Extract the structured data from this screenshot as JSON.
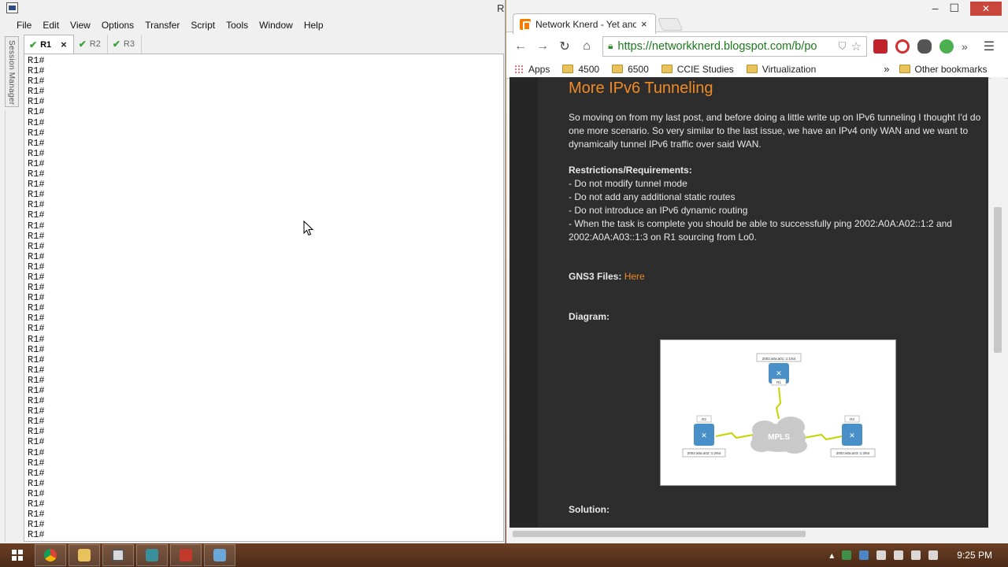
{
  "crt": {
    "title_fragment": "R",
    "menu": [
      "File",
      "Edit",
      "View",
      "Options",
      "Transfer",
      "Script",
      "Tools",
      "Window",
      "Help"
    ],
    "session_manager_label": "Session Manager",
    "tabs": [
      {
        "label": "R1",
        "active": true
      },
      {
        "label": "R2",
        "active": false
      },
      {
        "label": "R3",
        "active": false
      }
    ],
    "tab_close_glyph": "×",
    "terminal_prompt": "R1#",
    "terminal_line_count": 47
  },
  "chrome": {
    "tab_title": "Network Knerd - Yet anoth",
    "tab_close_glyph": "×",
    "url": "https://networkknerd.blogspot.com/b/po",
    "bookmarks": [
      {
        "label": "Apps",
        "icon": "apps-icon"
      },
      {
        "label": "4500",
        "icon": "folder-icon"
      },
      {
        "label": "6500",
        "icon": "folder-icon"
      },
      {
        "label": "CCIE Studies",
        "icon": "folder-icon"
      },
      {
        "label": "Virtualization",
        "icon": "folder-icon"
      }
    ],
    "bookmarks_overflow": "»",
    "other_bookmarks": "Other bookmarks"
  },
  "post": {
    "title": "More IPv6 Tunneling",
    "intro": "So moving on from my last post, and before doing a little write up on IPv6 tunneling I thought I'd do one more scenario. So very similar to the last issue, we have an IPv4 only WAN and we want to dynamically tunnel IPv6 traffic over said WAN.",
    "requirements_heading": "Restrictions/Requirements:",
    "requirements": [
      "- Do not modify tunnel mode",
      "- Do not add any additional static routes",
      "- Do not introduce an IPv6 dynamic routing",
      "- When the task is complete you should be able to successfully ping 2002:A0A:A02::1:2 and 2002:A0A:A03::1:3 on R1 sourcing from Lo0."
    ],
    "gns3_label": "GNS3 Files:",
    "gns3_link": "Here",
    "diagram_label": "Diagram:",
    "solution_label": "Solution:",
    "diagram": {
      "cloud_label": "MPLS",
      "routers": [
        {
          "name": "R2",
          "address": "2002:a0a:a02::1:2/64"
        },
        {
          "name": "R1",
          "address": "2002:a0a:a01::1:1/64"
        },
        {
          "name": "R3",
          "address": "2002:a0a:a03::1:3/64"
        }
      ]
    }
  },
  "taskbar": {
    "clock": "9:25 PM"
  },
  "colors": {
    "accent_orange": "#f08a24",
    "page_bg": "#2d2d2d",
    "url_green": "#1c7a1c"
  }
}
